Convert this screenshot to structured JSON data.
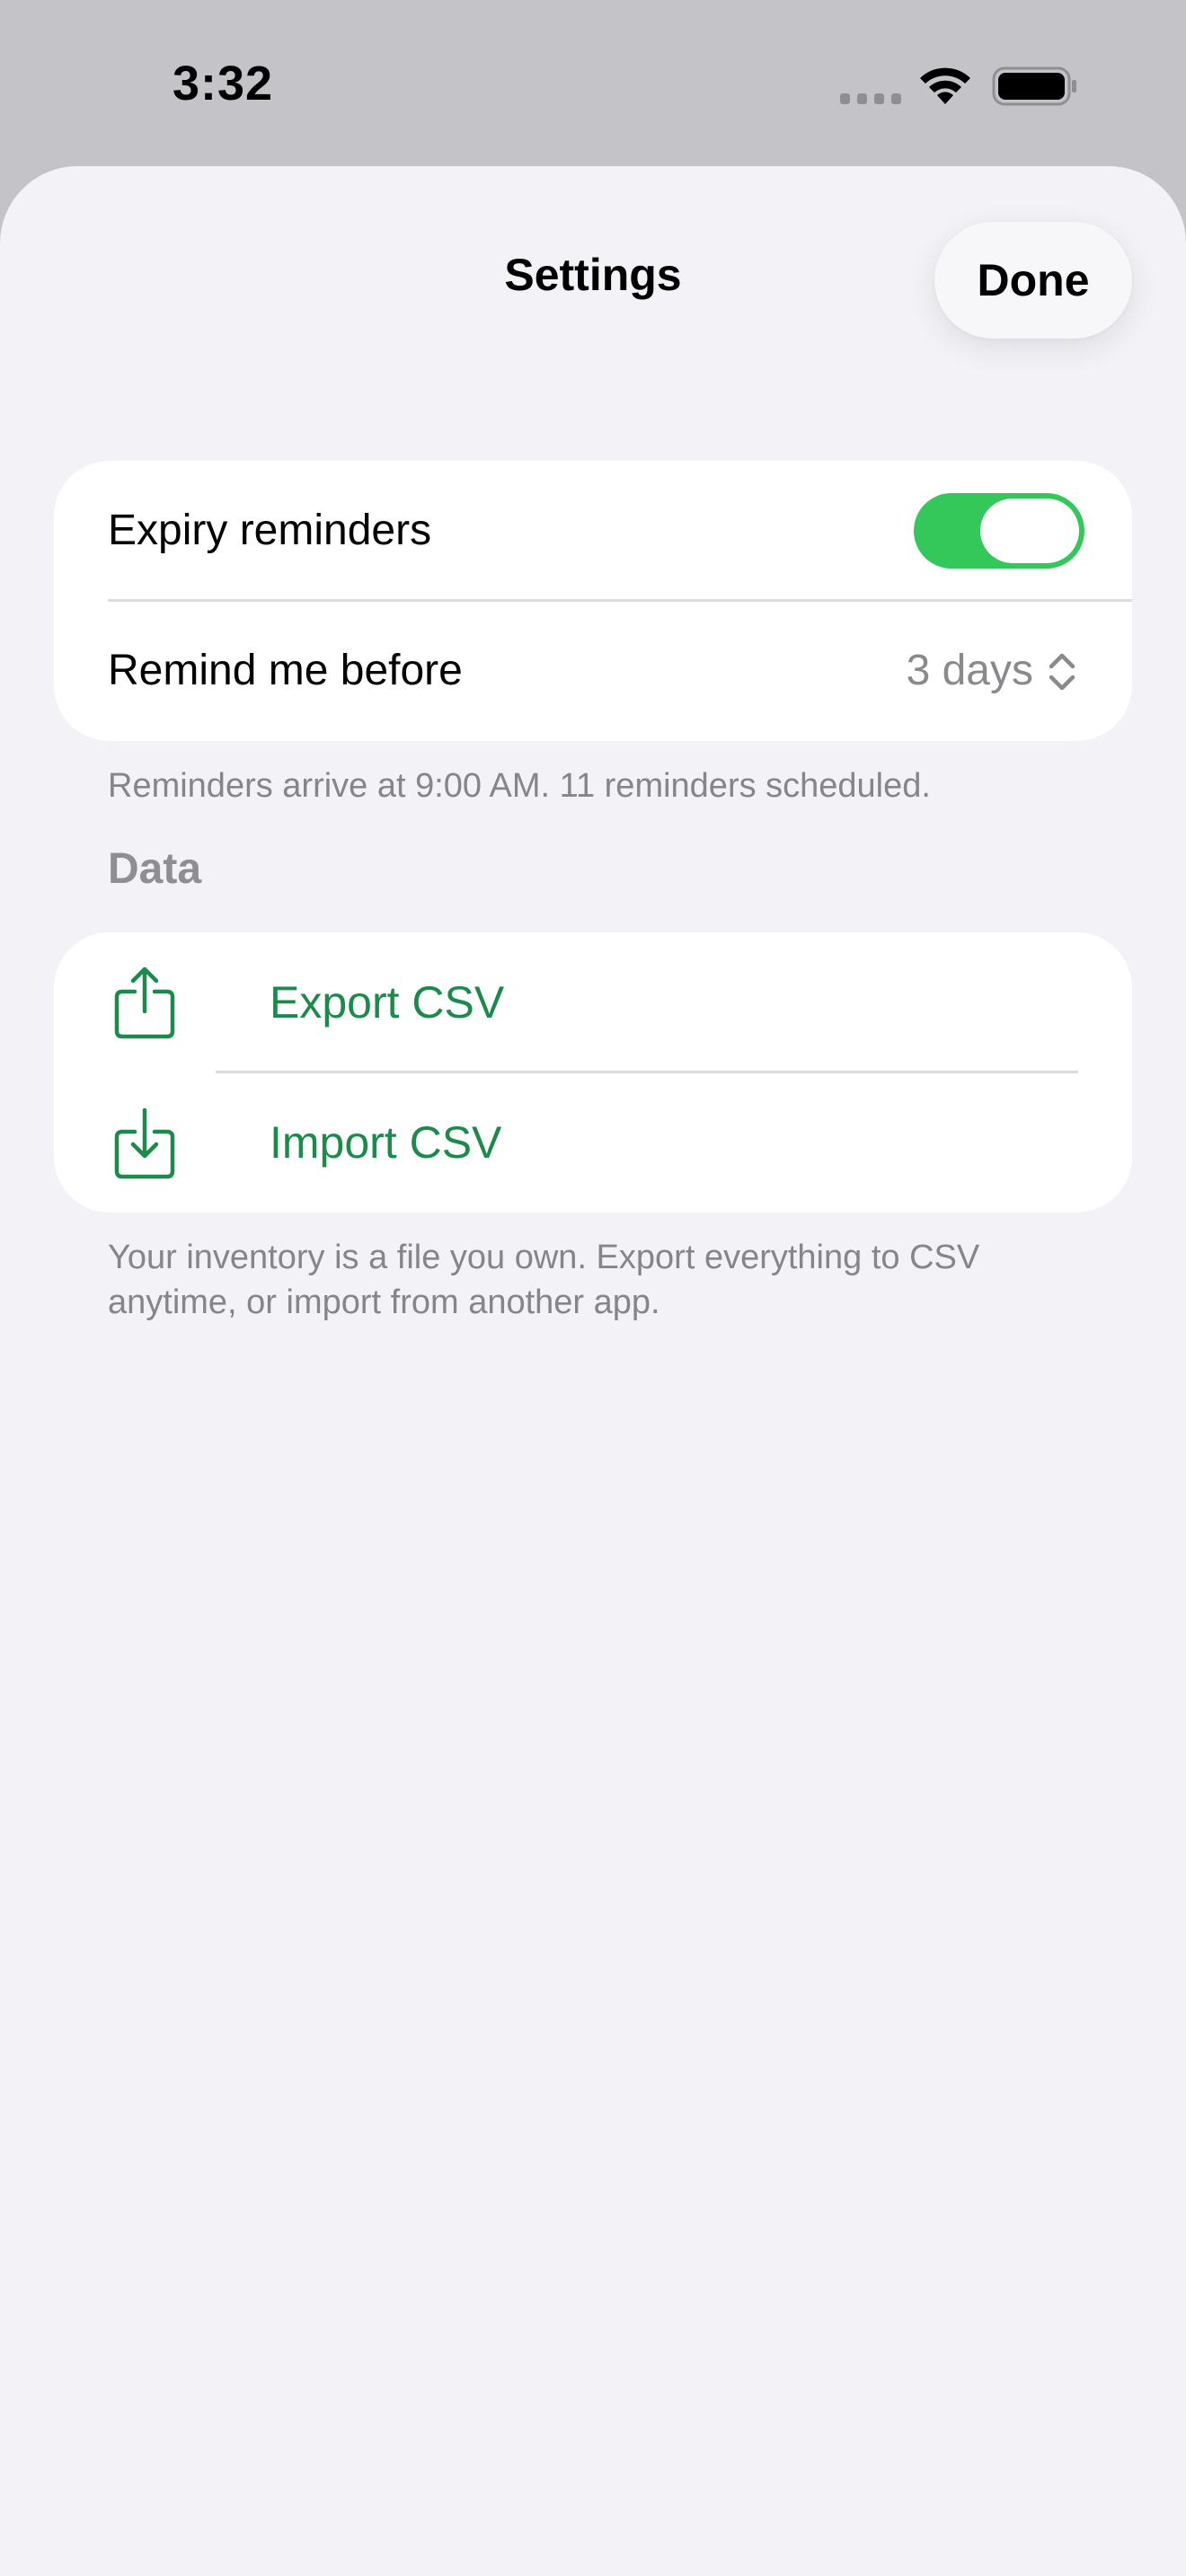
{
  "status_bar": {
    "time": "3:32",
    "icons": [
      "cellular-signal-icon",
      "wifi-icon",
      "battery-icon"
    ]
  },
  "nav": {
    "title": "Settings",
    "done_label": "Done"
  },
  "reminders_group": {
    "expiry_label": "Expiry reminders",
    "expiry_enabled": true,
    "remind_label": "Remind me before",
    "remind_value": "3 days",
    "footer": "Reminders arrive at 9:00 AM. 11 reminders scheduled."
  },
  "data_section": {
    "header": "Data",
    "export_label": "Export CSV",
    "export_icon": "share-export-icon",
    "import_label": "Import CSV",
    "import_icon": "import-tray-icon",
    "footer_line1": "Your inventory is a file you own. Export everything to CSV",
    "footer_line2": "anytime, or import from another app."
  },
  "colors": {
    "accent": "#1b8a4a",
    "toggle_on": "#34c759",
    "background": "#f2f2f7",
    "secondary_text": "#8a8a8e"
  }
}
